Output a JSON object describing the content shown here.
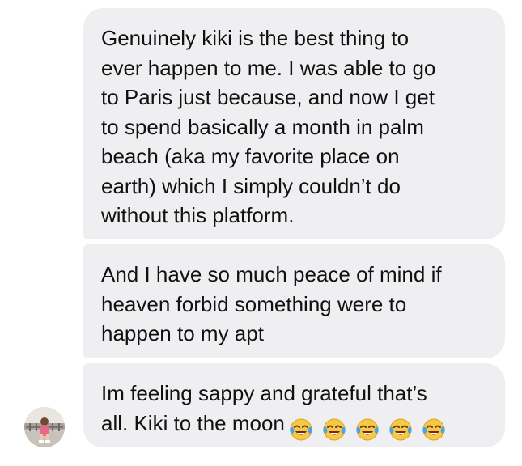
{
  "messages": [
    {
      "text": "Genuinely kiki is the best thing to\never happen to me. I was able to go\nto Paris just because, and now I get\nto spend basically a month in palm\nbeach (aka my favorite place on\nearth) which I simply couldn’t do\nwithout this platform."
    },
    {
      "text": "And I have so much peace of mind if\nheaven forbid something were to\nhappen to my apt"
    },
    {
      "text": "Im feeling sappy and grateful that’s\nall. Kiki to the moon",
      "emoji": "face-with-tears-of-joy-icon",
      "emoji_count": 5
    }
  ],
  "colors": {
    "bubble": "#efeff1",
    "text": "#111111",
    "emoji_face": "#f7c845",
    "emoji_tears": "#4aa3e6"
  }
}
